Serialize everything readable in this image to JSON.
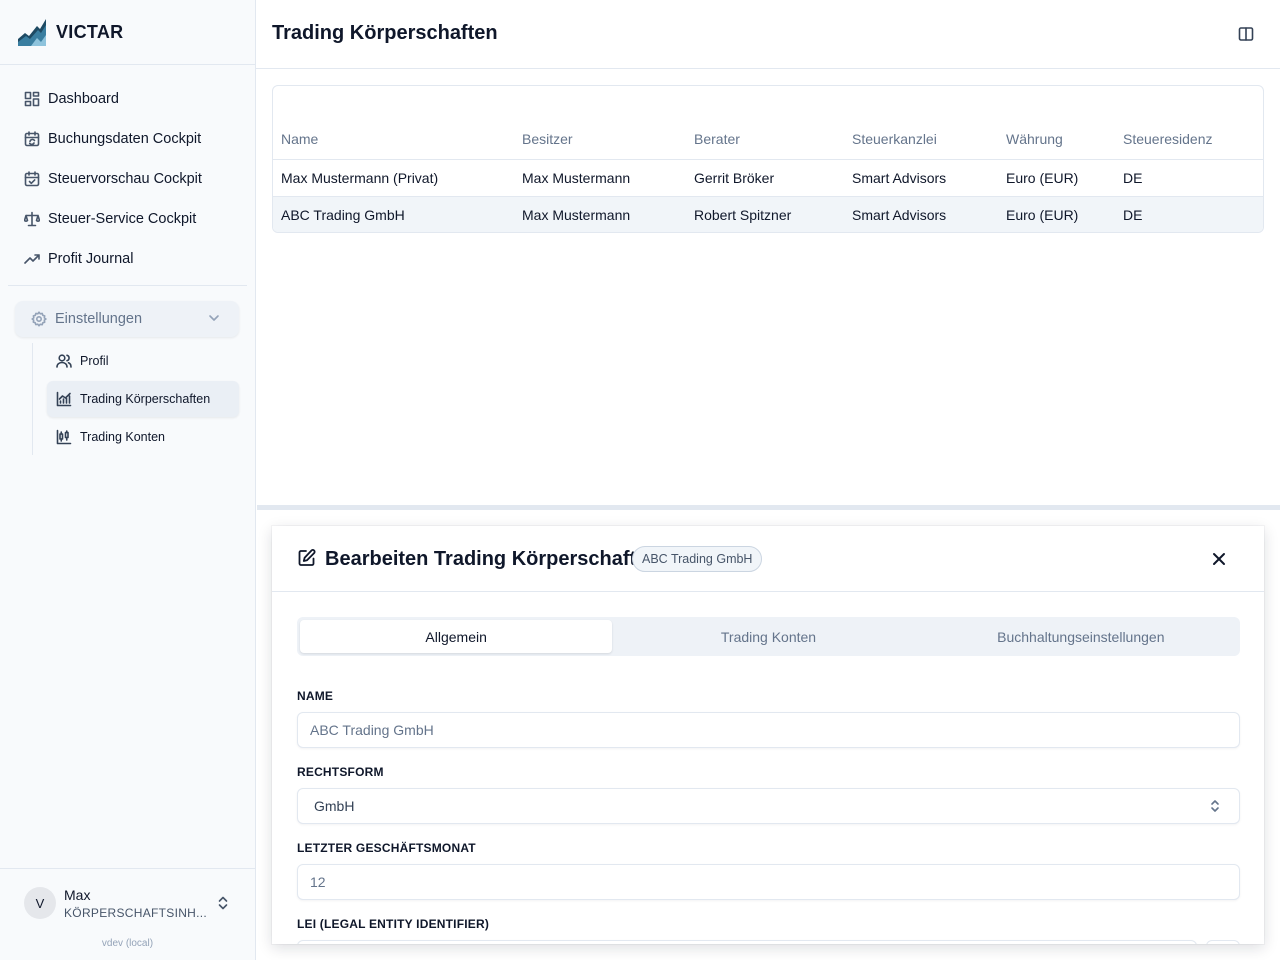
{
  "brand": {
    "name": "VICTAR"
  },
  "sidebar": {
    "items": [
      {
        "label": "Dashboard",
        "icon": "dashboard-icon"
      },
      {
        "label": "Buchungsdaten Cockpit",
        "icon": "calendar-sync-icon"
      },
      {
        "label": "Steuervorschau Cockpit",
        "icon": "calendar-check-icon"
      },
      {
        "label": "Steuer-Service Cockpit",
        "icon": "scale-icon"
      },
      {
        "label": "Profit Journal",
        "icon": "trending-up-icon"
      }
    ],
    "settings": {
      "label": "Einstellungen",
      "icon": "settings-icon",
      "expanded": true,
      "items": [
        {
          "label": "Profil",
          "icon": "users-icon"
        },
        {
          "label": "Trading Körperschaften",
          "icon": "chart-icon",
          "active": true
        },
        {
          "label": "Trading Konten",
          "icon": "candlestick-icon"
        }
      ]
    },
    "user": {
      "initial": "V",
      "name": "Max",
      "role": "KÖRPERSCHAFTSINH...",
      "version": "vdev (local)"
    }
  },
  "header": {
    "title": "Trading Körperschaften"
  },
  "table": {
    "columns": [
      "Name",
      "Besitzer",
      "Berater",
      "Steuerkanzlei",
      "Währung",
      "Steueresidenz"
    ],
    "rows": [
      [
        "Max Mustermann (Privat)",
        "Max Mustermann",
        "Gerrit Bröker",
        "Smart Advisors",
        "Euro (EUR)",
        "DE"
      ],
      [
        "ABC Trading GmbH",
        "Max Mustermann",
        "Robert Spitzner",
        "Smart Advisors",
        "Euro (EUR)",
        "DE"
      ]
    ],
    "selected_row": 1
  },
  "editor": {
    "title": "Bearbeiten Trading Körperschaft",
    "badge": "ABC Trading GmbH",
    "tabs": [
      "Allgemein",
      "Trading Konten",
      "Buchhaltungseinstellungen"
    ],
    "active_tab": 0,
    "fields": {
      "name": {
        "label": "NAME",
        "placeholder": "ABC Trading GmbH"
      },
      "rechtsform": {
        "label": "RECHTSFORM",
        "value": "GmbH"
      },
      "geschaeftsmonat": {
        "label": "LETZTER GESCHÄFTSMONAT",
        "placeholder": "12"
      },
      "lei": {
        "label": "LEI (LEGAL ENTITY IDENTIFIER)",
        "placeholder": ""
      }
    }
  }
}
